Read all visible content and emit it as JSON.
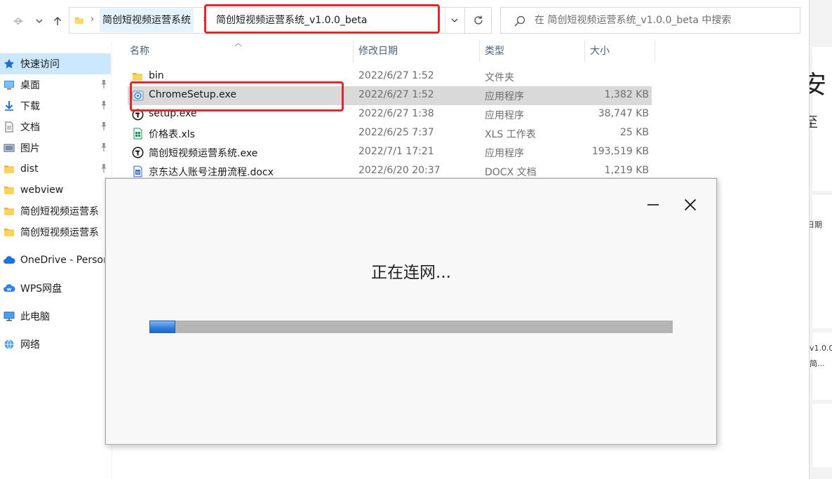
{
  "breadcrumb": {
    "parent": "简创短视频运营系统",
    "current": "简创短视频运营系统_v1.0.0_beta"
  },
  "search": {
    "placeholder": "在 简创短视频运营系统_v1.0.0_beta 中搜索"
  },
  "icons": {
    "back": "arrow-left-icon",
    "forward": "arrow-right-icon",
    "recent": "chevron-down-icon",
    "up": "arrow-up-icon",
    "refresh": "refresh-icon",
    "search": "search-icon"
  },
  "sidebar": {
    "items": [
      {
        "label": "快速访问",
        "icon": "star-icon",
        "pinned": false,
        "selected": true
      },
      {
        "label": "桌面",
        "icon": "desktop-icon",
        "pinned": true
      },
      {
        "label": "下载",
        "icon": "download-icon",
        "pinned": true
      },
      {
        "label": "文档",
        "icon": "document-icon",
        "pinned": true
      },
      {
        "label": "图片",
        "icon": "picture-icon",
        "pinned": true
      },
      {
        "label": "dist",
        "icon": "folder-icon",
        "pinned": true
      },
      {
        "label": "webview",
        "icon": "folder-icon",
        "pinned": false
      },
      {
        "label": "简创短视频运营系",
        "icon": "folder-icon",
        "pinned": false
      },
      {
        "label": "简创短视频运营系",
        "icon": "folder-icon",
        "pinned": false
      },
      {
        "label": "OneDrive - Person",
        "icon": "cloud-icon",
        "pinned": false
      },
      {
        "label": "WPS网盘",
        "icon": "wps-cloud-icon",
        "pinned": false
      },
      {
        "label": "此电脑",
        "icon": "computer-icon",
        "pinned": false
      },
      {
        "label": "网络",
        "icon": "network-icon",
        "pinned": false
      }
    ]
  },
  "columns": {
    "name": "名称",
    "date": "修改日期",
    "type": "类型",
    "size": "大小"
  },
  "files": [
    {
      "name": "bin",
      "date": "2022/6/27 1:52",
      "type": "文件夹",
      "size": "",
      "icon": "folder-icon"
    },
    {
      "name": "ChromeSetup.exe",
      "date": "2022/6/27 1:52",
      "type": "应用程序",
      "size": "1,382 KB",
      "icon": "installer-icon",
      "selected": true
    },
    {
      "name": "setup.exe",
      "date": "2022/6/27 1:38",
      "type": "应用程序",
      "size": "38,747 KB",
      "icon": "app-icon"
    },
    {
      "name": "价格表.xls",
      "date": "2022/6/25 7:37",
      "type": "XLS 工作表",
      "size": "25 KB",
      "icon": "spreadsheet-icon"
    },
    {
      "name": "简创短视频运营系统.exe",
      "date": "2022/7/1 17:21",
      "type": "应用程序",
      "size": "193,519 KB",
      "icon": "app-icon"
    },
    {
      "name": "京东达人账号注册流程.docx",
      "date": "2022/6/20 20:37",
      "type": "DOCX 文档",
      "size": "1,219 KB",
      "icon": "word-doc-icon"
    }
  ],
  "right_panel": {
    "heading": "安",
    "subtext": "至",
    "snippet1": "日期",
    "snippet2": "v1.0.0",
    "snippet3": "简..."
  },
  "dialog": {
    "status": "正在连网...",
    "progress": 0.05
  },
  "colors": {
    "highlight_red": "#e8262a",
    "selection": "#d9d9d9",
    "sidebar_selection": "#cce8ff",
    "progress_fill": "#2f7ddc",
    "progress_track": "#b5b5b5"
  }
}
